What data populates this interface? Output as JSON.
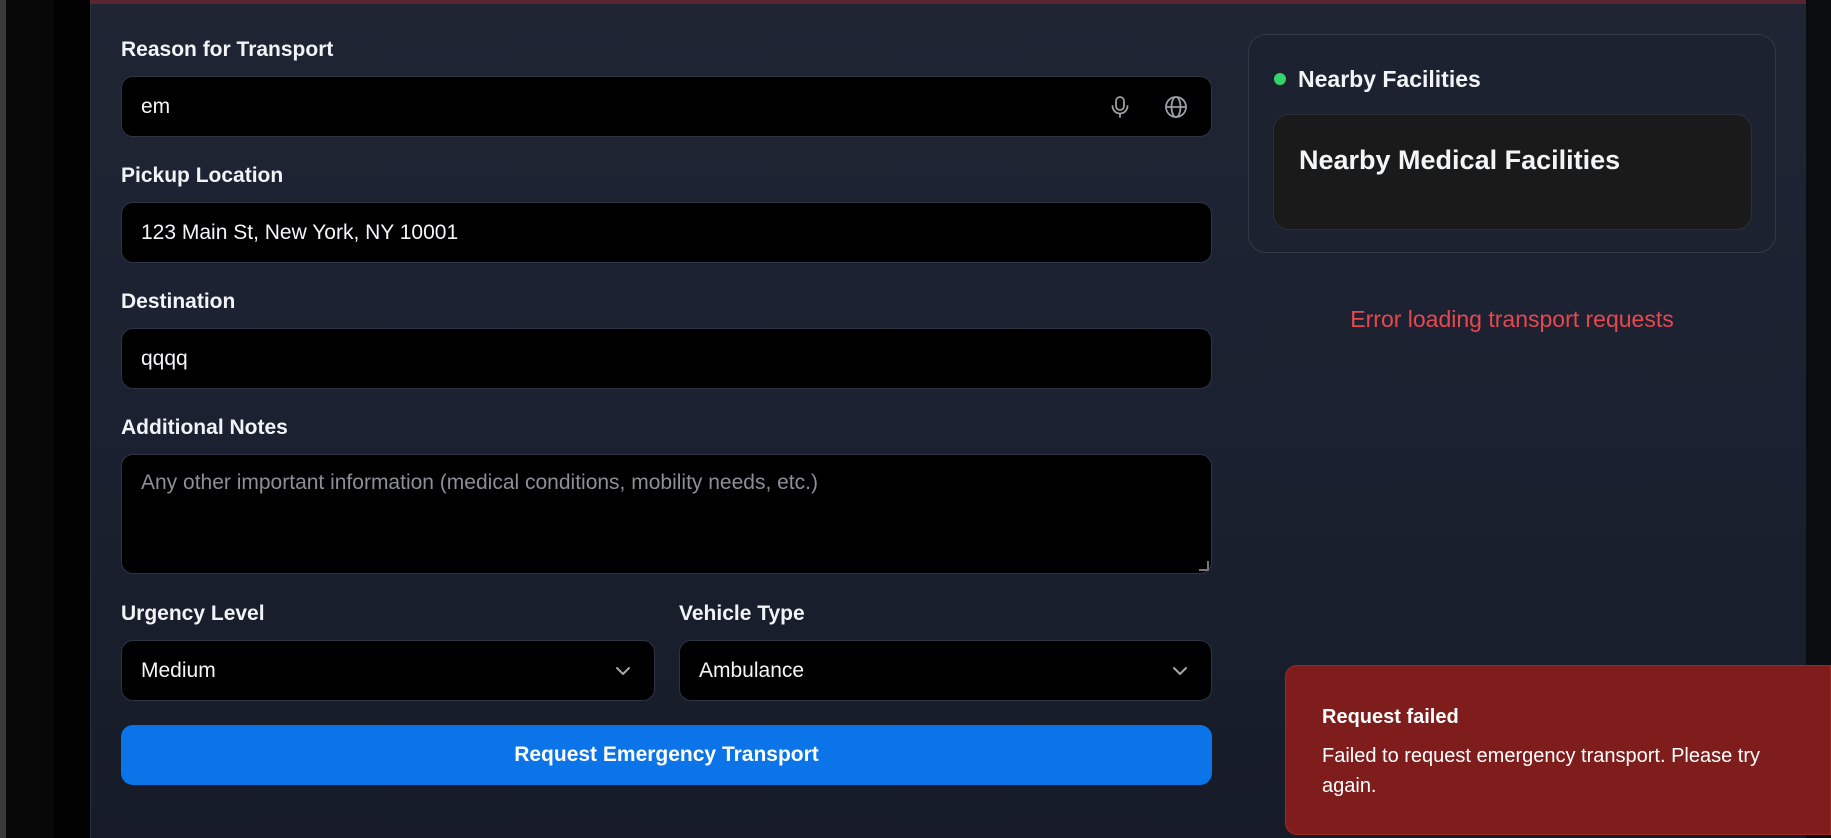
{
  "form": {
    "reason": {
      "label": "Reason for Transport",
      "value": "em"
    },
    "pickup": {
      "label": "Pickup Location",
      "value": "123 Main St, New York, NY 10001"
    },
    "destination": {
      "label": "Destination",
      "value": "qqqq"
    },
    "notes": {
      "label": "Additional Notes",
      "placeholder": "Any other important information (medical conditions, mobility needs, etc.)"
    },
    "urgency": {
      "label": "Urgency Level",
      "value": "Medium"
    },
    "vehicle": {
      "label": "Vehicle Type",
      "value": "Ambulance"
    },
    "submit_label": "Request Emergency Transport"
  },
  "facilities": {
    "header": "Nearby Facilities",
    "card_title": "Nearby Medical Facilities",
    "status_color": "#34d36b"
  },
  "requests": {
    "error": "Error loading transport requests"
  },
  "toast": {
    "title": "Request failed",
    "message": "Failed to request emergency transport. Please try again."
  },
  "icons": {
    "reason_mic": "microphone-icon",
    "reason_globe": "globe-icon",
    "select_chevron": "chevron-down-icon"
  },
  "colors": {
    "accent": "#0a74e8",
    "error": "#e8474f",
    "toast_bg": "#7f1d1d"
  }
}
